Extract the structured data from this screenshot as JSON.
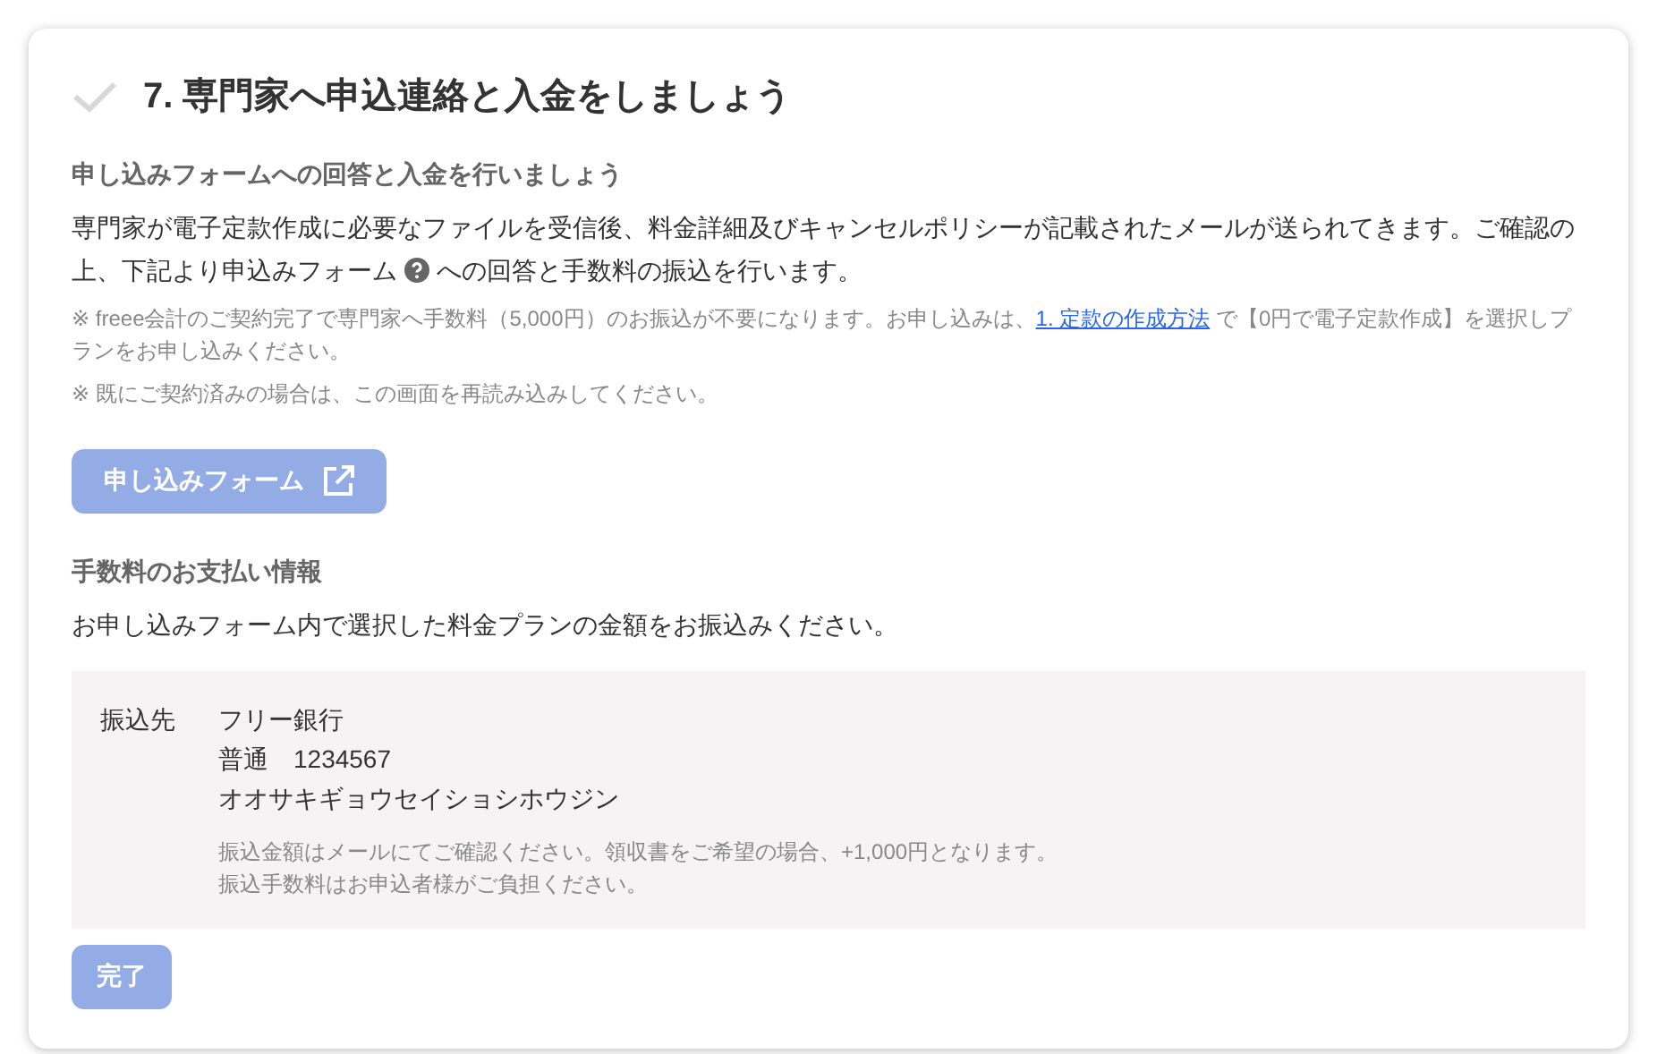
{
  "step": {
    "title": "7. 専門家へ申込連絡と入金をしましょう",
    "done": false
  },
  "application": {
    "heading": "申し込みフォームへの回答と入金を行いましょう",
    "body_before": "専門家が電子定款作成に必要なファイルを受信後、料金詳細及びキャンセルポリシーが記載されたメールが送られてきます。ご確認の上、下記より申込みフォーム",
    "body_after": "への回答と手数料の振込を行います。",
    "note_before": "※ freee会計のご契約完了で専門家へ手数料（5,000円）のお振込が不要になります。お申し込みは、",
    "note_link": "1. 定款の作成方法",
    "note_after": " で【0円で電子定款作成】を選択しプランをお申し込みください。",
    "note_2": "※ 既にご契約済みの場合は、この画面を再読み込みしてください。",
    "button": {
      "label": "申し込みフォーム",
      "disabled": true
    }
  },
  "payment": {
    "heading": "手数料のお支払い情報",
    "description": "お申し込みフォーム内で選択した料金プランの金額をお振込みください。",
    "label": "振込先",
    "lines": [
      "フリー銀行",
      "普通　1234567",
      "オオサキギョウセイショシホウジン"
    ],
    "notes": [
      "振込金額はメールにてご確認ください。領収書をご希望の場合、+1,000円となります。",
      "振込手数料はお申込者様がご負担ください。"
    ]
  },
  "complete_button": {
    "label": "完了",
    "disabled": true
  }
}
